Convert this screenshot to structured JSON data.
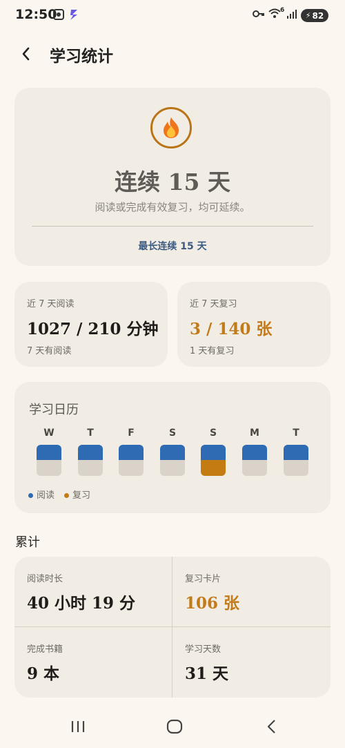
{
  "status_bar": {
    "time": "12:50",
    "battery": "82",
    "signal_sup": "6"
  },
  "app_bar": {
    "title": "学习统计"
  },
  "streak": {
    "title": "连续 15 天",
    "subtitle": "阅读或完成有效复习，均可延续。",
    "best": "最长连续 15 天",
    "icon": "flame-icon"
  },
  "weekly": {
    "reading": {
      "label": "近 7 天阅读",
      "value": "1027 / 210 分钟",
      "sub": "7 天有阅读"
    },
    "review": {
      "label": "近 7 天复习",
      "value": "3 / 140 张",
      "sub": "1 天有复习"
    }
  },
  "calendar": {
    "title": "学习日历",
    "days": [
      {
        "label": "W",
        "read": true,
        "review": false
      },
      {
        "label": "T",
        "read": true,
        "review": false
      },
      {
        "label": "F",
        "read": true,
        "review": false
      },
      {
        "label": "S",
        "read": true,
        "review": false
      },
      {
        "label": "S",
        "read": true,
        "review": true
      },
      {
        "label": "M",
        "read": true,
        "review": false
      },
      {
        "label": "T",
        "read": true,
        "review": false
      }
    ],
    "legend": {
      "read": "阅读",
      "review": "复习"
    }
  },
  "totals": {
    "title": "累计",
    "items": [
      {
        "label": "阅读时长",
        "value": "40 小时 19 分"
      },
      {
        "label": "复习卡片",
        "value": "106 张"
      },
      {
        "label": "完成书籍",
        "value": "9 本"
      },
      {
        "label": "学习天数",
        "value": "31 天"
      }
    ]
  },
  "colors": {
    "accent_blue": "#2f6bb2",
    "accent_orange": "#c27b1a",
    "background": "#fbf7f0",
    "card": "#f1ede5"
  }
}
